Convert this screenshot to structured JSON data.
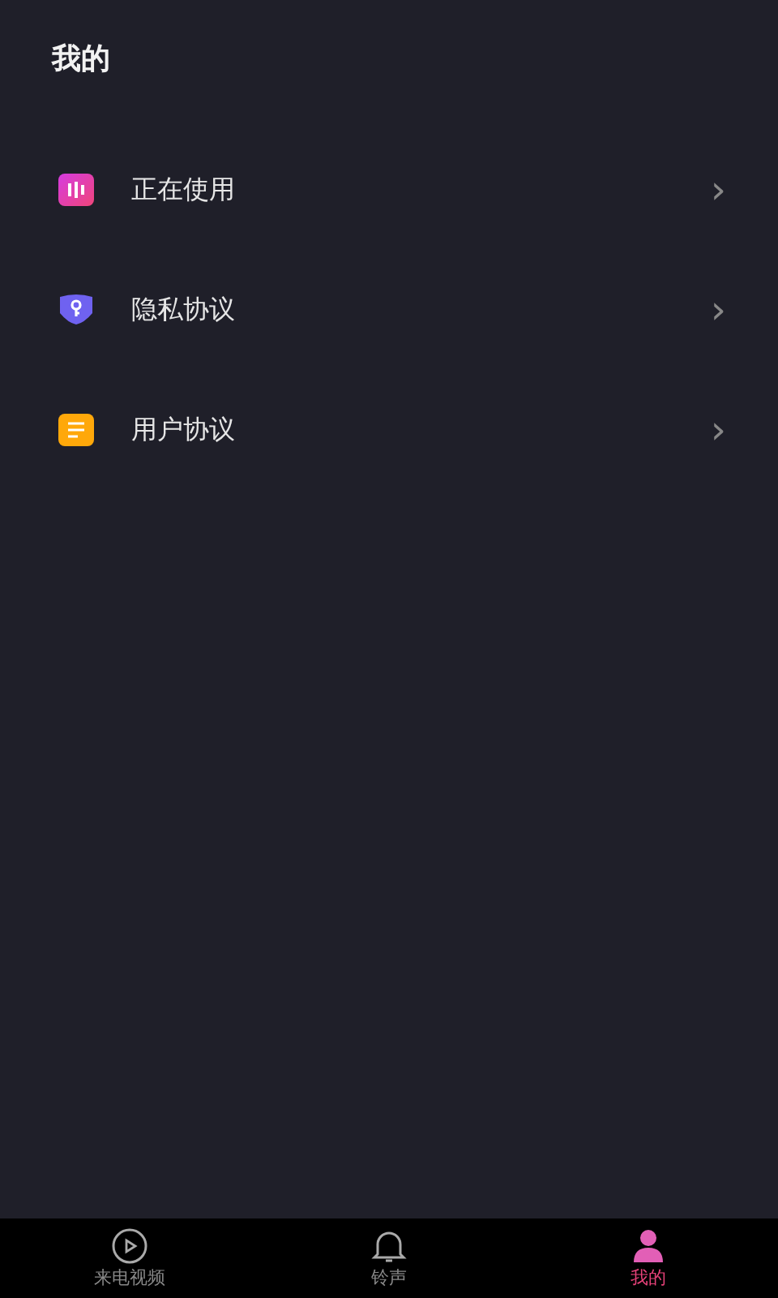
{
  "header": {
    "title": "我的"
  },
  "menu": [
    {
      "kind": "playing",
      "label": "正在使用",
      "chevron": "›"
    },
    {
      "kind": "privacy",
      "label": "隐私协议",
      "chevron": "›"
    },
    {
      "kind": "agreement",
      "label": "用户协议",
      "chevron": "›"
    }
  ],
  "tab_bar": [
    {
      "kind": "video",
      "label": "来电视频",
      "selected": false
    },
    {
      "kind": "bell",
      "label": "铃声",
      "selected": false
    },
    {
      "kind": "user",
      "label": "我的",
      "selected": true
    }
  ]
}
